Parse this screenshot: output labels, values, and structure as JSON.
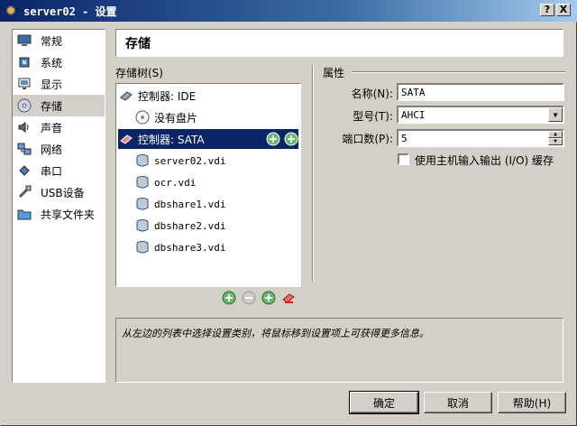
{
  "window": {
    "title": "server02 - 设置",
    "help_btn": "?",
    "close_btn": "X"
  },
  "sidebar": {
    "items": [
      {
        "label": "常规",
        "icon": "monitor-icon"
      },
      {
        "label": "系统",
        "icon": "chip-icon"
      },
      {
        "label": "显示",
        "icon": "display-icon"
      },
      {
        "label": "存储",
        "icon": "disk-icon",
        "selected": true
      },
      {
        "label": "声音",
        "icon": "speaker-icon"
      },
      {
        "label": "网络",
        "icon": "network-icon"
      },
      {
        "label": "串口",
        "icon": "serial-icon"
      },
      {
        "label": "USB设备",
        "icon": "usb-icon"
      },
      {
        "label": "共享文件夹",
        "icon": "folder-icon"
      }
    ]
  },
  "page": {
    "heading": "存储"
  },
  "tree": {
    "label": "存储树(S)",
    "controllers": [
      {
        "label": "控制器: IDE",
        "children": [
          "没有盘片"
        ]
      },
      {
        "label": "控制器: SATA",
        "selected": true,
        "children": [
          "server02.vdi",
          "ocr.vdi",
          "dbshare1.vdi",
          "dbshare2.vdi",
          "dbshare3.vdi"
        ]
      }
    ]
  },
  "attributes": {
    "title": "属性",
    "name_label": "名称(N):",
    "name_value": "SATA",
    "type_label": "型号(T):",
    "type_value": "AHCI",
    "ports_label": "端口数(P):",
    "ports_value": "5",
    "host_io_label": "使用主机输入输出 (I/O) 缓存"
  },
  "info": {
    "text": "从左边的列表中选择设置类别，将鼠标移到设置项上可获得更多信息。"
  },
  "buttons": {
    "ok": "确定",
    "cancel": "取消",
    "help": "帮助(H)"
  }
}
